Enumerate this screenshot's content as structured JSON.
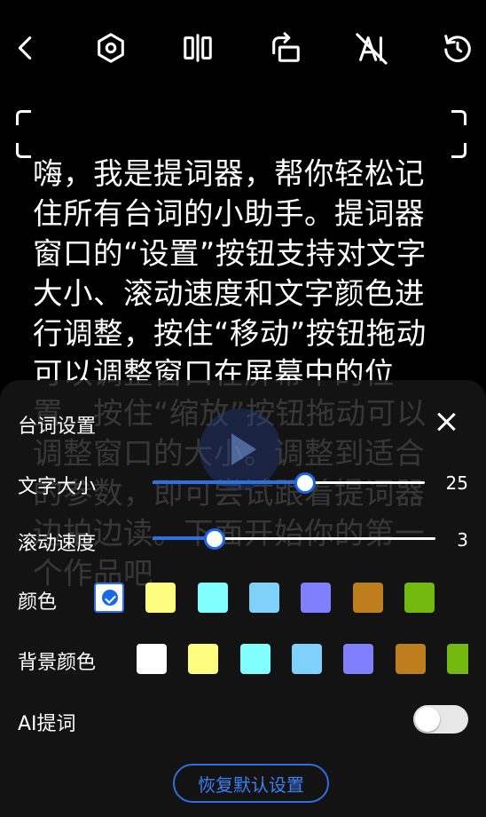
{
  "toolbar": {
    "icons": [
      "back-icon",
      "settings-icon",
      "mirror-icon",
      "rotate-screen-icon",
      "ai-off-icon",
      "refresh-icon"
    ]
  },
  "script": {
    "text": "嗨，我是提词器，帮你轻松记住所有台词的小助手。提词器窗口的“设置”按钮支持对文字大小、滚动速度和文字颜色进行调整，按住“移动”按钮拖动可以调整窗口在屏幕中的位置，按住“缩放”按钮拖动可以调整窗口的大小。调整到适合的参数，即可尝试跟着提词器边拍边读。下面开始你的第一个作品吧"
  },
  "panel": {
    "title": "台词设置",
    "font_size": {
      "label": "文字大小",
      "value": "25",
      "fraction": 0.56
    },
    "scroll_speed": {
      "label": "滚动速度",
      "value": "3",
      "fraction": 0.22
    },
    "text_color": {
      "label": "颜色",
      "selected_index": 0,
      "swatches": [
        "#ffffff",
        "#fdfd80",
        "#80fefe",
        "#80d1fa",
        "#8080fe",
        "#bf7e1e",
        "#73b80e"
      ]
    },
    "bg_color": {
      "label": "背景颜色",
      "swatches": [
        "#ffffff",
        "#fdfd80",
        "#80fefe",
        "#80d1fa",
        "#8080fe",
        "#bf7e1e",
        "#73b80e"
      ]
    },
    "ai_prompt": {
      "label": "AI提词",
      "enabled": false
    },
    "reset_label": "恢复默认设置"
  },
  "colors": {
    "accent": "#2f6fe4",
    "panel_bg": "#161616"
  }
}
